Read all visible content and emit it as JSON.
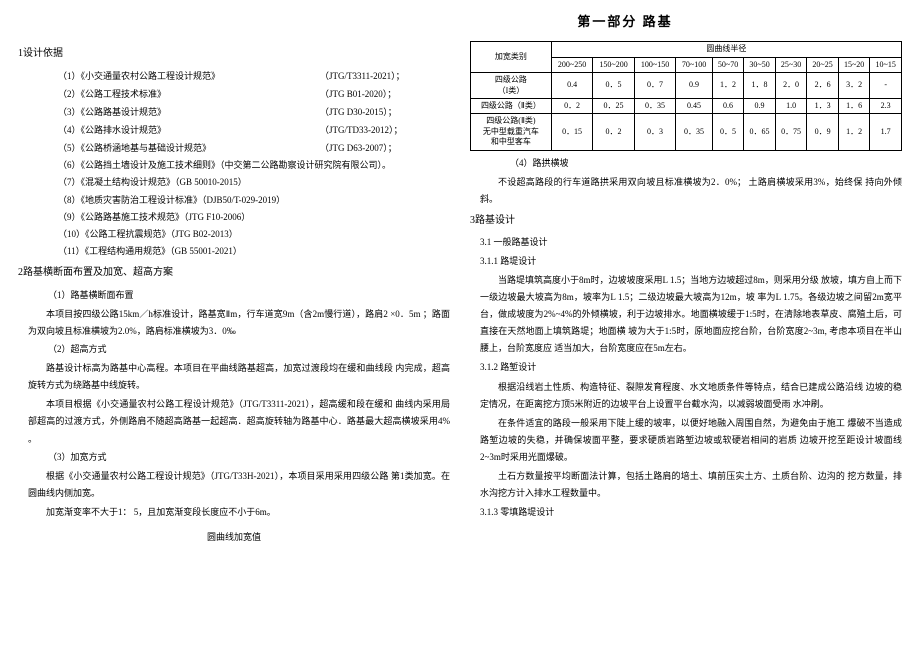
{
  "part_title": "第一部分    路基",
  "left": {
    "h1_1": "1设计依据",
    "refs": [
      {
        "label": "（1）《小交通量农村公路工程设计规范》",
        "code": "（JTG/T3311-2021）；"
      },
      {
        "label": "（2）《公路工程技术标准》",
        "code": "（JTG B01-2020）；"
      },
      {
        "label": "（3）《公路路基设计规范》",
        "code": "（JTG D30-2015）；"
      },
      {
        "label": "（4）《公路排水设计规范》",
        "code": "（JTG/TD33-2012）；"
      },
      {
        "label": "（5）《公路桥涵地基与基础设计规范》",
        "code": "（JTG D63-2007）；"
      }
    ],
    "ref6": "（6）《公路挡土墙设计及施工技术细则》（中交第二公路勘察设计研究院有限公司）。",
    "ref7": "（7）《混凝土结构设计规范》（GB 50010-2015）",
    "ref8": "（8）《地质灾害防治工程设计标准》（DJB50/T-029-2019）",
    "ref9": "（9）《公路路基施工技术规范》（JTG F10-2006）",
    "ref10": "（10）《公路工程抗震规范》（JTG B02-2013）",
    "ref11": "（11）《工程结构通用规范》（GB 55001-2021）",
    "h1_2": "2路基横断面布置及加宽、超高方案",
    "sub_1": "（1）路基横断面布置",
    "p1": "本项目按四级公路15km／h标准设计，路基宽Ⅱm，行车道宽9m（含2m慢行道），路肩2 ×0．5m ；路面为双向坡且标准横坡为2.0%，路肩标准横坡为3．0‰",
    "sub_2": "（2）超高方式",
    "p2": "路基设计标高为路基中心高程。本项目在平曲线路基超高，加宽过渡段均在缓和曲线段 内完成，超高旋转方式为绕路基中线旋转。",
    "p3": "本项目根据《小交通量农村公路工程设计规范》（JTG/T3311-2021），超高缓和段在缓和 曲线内采用局部超高的过渡方式，外侧路肩不随超高路基一起超高．超高旋转轴为路基中心．路基最大超高横坡采用4% 。",
    "sub_3": "（3）加宽方式",
    "p4": "根据《小交通量农村公路工程设计规范》（JTG/T33H-2021），本项目采用采用四级公路 第1类加宽。在圆曲线内侧加宽。",
    "p5": "加宽渐变率不大于1： 5，且加宽渐变段长度应不小于6m。",
    "caption": "圆曲线加宽值"
  },
  "table": {
    "head_cat": "加宽类别",
    "head_radius": "圆曲线半径",
    "cols": [
      "200~250",
      "150~200",
      "100~150",
      "70~100",
      "50~70",
      "30~50",
      "25~30",
      "20~25",
      "15~20",
      "10~15"
    ],
    "rows": [
      {
        "label": "四级公路\n（I类）",
        "vals": [
          "0.4",
          "0．5",
          "0．7",
          "0.9",
          "1．2",
          "1．8",
          "2．0",
          "2．6",
          "3．2",
          "-"
        ]
      },
      {
        "label": "四级公路（Ⅱ类）",
        "vals": [
          "0．2",
          "0．25",
          "0．35",
          "0.45",
          "0.6",
          "0.9",
          "1.0",
          "1．3",
          "1．6",
          "2.3"
        ]
      },
      {
        "label": "四级公路(Ⅱ类)\n无中型载重汽车\n和中型客车",
        "vals": [
          "0．15",
          "0．2",
          "0．3",
          "0．35",
          "0．5",
          "0．65",
          "0．75",
          "0．9",
          "1．2",
          "1.7"
        ]
      }
    ]
  },
  "right": {
    "sub_4": "（4）路拱横坡",
    "p_r1": "不设超高路段的行车道路拱采用双向坡且标准横坡为2．0%； 土路肩横坡采用3%，始终保 持向外倾斜。",
    "h1_3": "3路基设计",
    "h2_1": "3.1 一般路基设计",
    "h3_1": "3.1.1 路堤设计",
    "p_r2": "当路堤填筑高度小于8m时，边坡坡度采用L  1.5；当地方边坡超过8m，则采用分级  放坡，填方自上而下一级边坡最大坡高为8m，坡率为L 1.5；二级边坡最大坡高为12m，坡 率为L 1.75。各级边坡之间留2m宽平台，做成坡度为2%~4%的外倾横坡，利于边坡排水。地面横坡缓于1:5时，在清除地表草皮、腐殖土后，可直接在天然地面上填筑路堤；地面横 坡为大于1:5时，原地面应挖台阶，台阶宽度2~3m, 考虑本项目在半山腰上，台阶宽度应 适当加大，台阶宽度应在5m左右。",
    "h3_2": "3.1.2 路堑设计",
    "p_r3": "根据沿线岩土性质、构造特征、裂隙发育程度、水文地质条件等特点，结合已建成公路沿线 边坡的稳定情况，在距离挖方顶5米附近的边坡平台上设置平台截水沟，以减弱坡面受雨 水冲刷。",
    "p_r4": "在条件适宜的路段一般采用下陡上缓的坡率，以便好地融入周围自然，为避免由于施工 爆破不当造成路堑边坡的失稳，并确保坡面平整，要求硬质岩路堑边坡或软硬岩相间的岩质 边坡开挖至距设计坡面线2~3m时采用光面爆破。",
    "p_r5": "土石方数量按平均断面法计算，包括土路肩的培土、填前压实土方、土质台阶、边沟的 挖方数量，排水沟挖方计入排水工程数量中。",
    "h3_3": "3.1.3 零填路堤设计"
  }
}
